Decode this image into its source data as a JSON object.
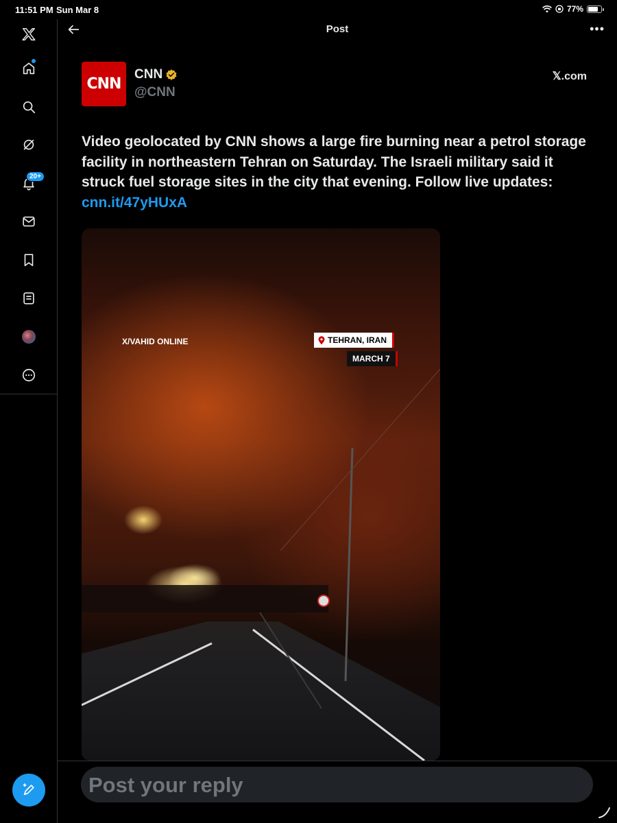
{
  "status_bar": {
    "time": "11:51 PM",
    "date": "Sun Mar 8",
    "battery": "77%"
  },
  "sidebar": {
    "notifications_badge": "20+",
    "items": [
      "x-logo",
      "home",
      "search",
      "grok",
      "notifications",
      "messages",
      "bookmarks",
      "lists",
      "profile",
      "more"
    ]
  },
  "header": {
    "title": "Post"
  },
  "post": {
    "author_name": "CNN",
    "author_handle": "@CNN",
    "logo_text": "CNN",
    "source": "𝕏.com",
    "text": "Video geolocated by CNN shows a large fire burning near a petrol storage facility in northeastern Tehran on Saturday. The Israeli military said it struck fuel storage sites in the city that evening. Follow live updates: ",
    "link": "cnn.it/47yHUxA",
    "media": {
      "credit": "X/VAHID ONLINE",
      "location": "TEHRAN, IRAN",
      "date": "MARCH 7"
    }
  },
  "reply": {
    "placeholder": "Post your reply"
  },
  "colors": {
    "accent": "#1d9bf0",
    "cnn_red": "#cc0000",
    "background": "#000000",
    "muted": "#71767b"
  }
}
